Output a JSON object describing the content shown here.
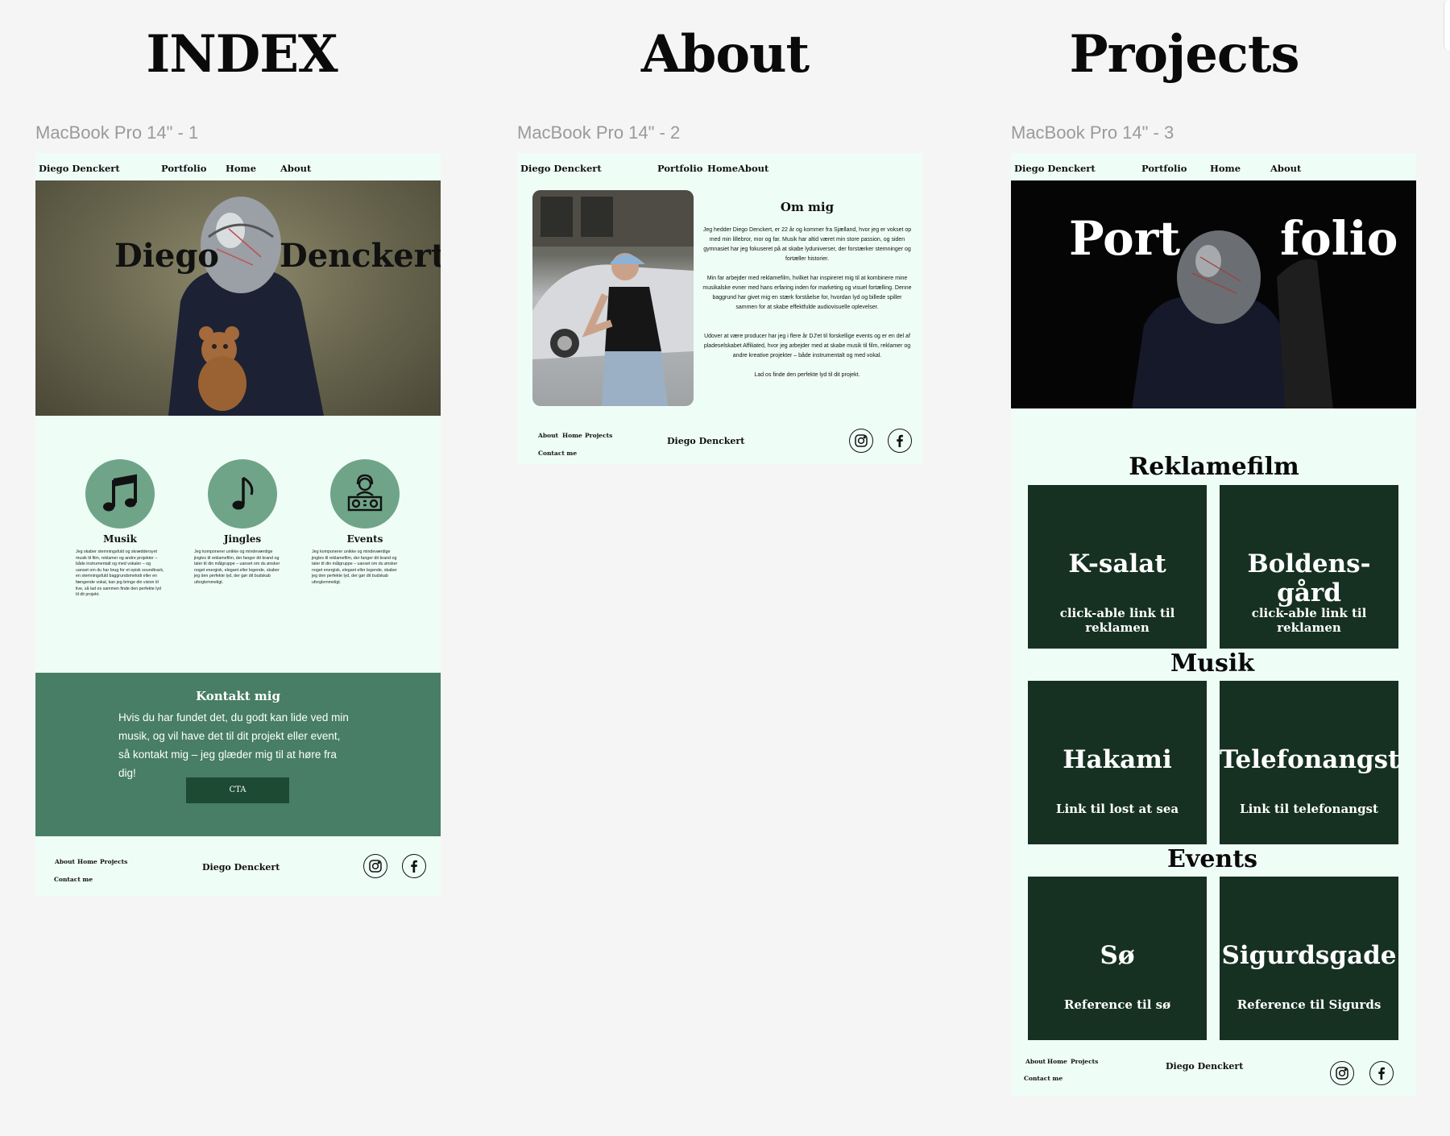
{
  "headings": {
    "index": "INDEX",
    "about": "About",
    "projects": "Projects"
  },
  "frame_labels": {
    "f1": "MacBook Pro 14\" - 1",
    "f2": "MacBook Pro 14\" - 2",
    "f3": "MacBook Pro 14\" - 3"
  },
  "nav": {
    "brand": "Diego Denckert",
    "portfolio": "Portfolio",
    "home": "Home",
    "about": "About"
  },
  "index": {
    "hero_first": "Diego",
    "hero_last": "Denckert",
    "services": [
      {
        "title": "Musik",
        "icon": "music-notes-icon",
        "text": "Jeg skaber stemningsfuld og skræddersyet musik til film, reklamer og andre projekter – både instrumentalt og med vokaler – og uanset om du har brug for et episk soundtrack, en stemningsfuld baggrundsmelodi eller en fængende vokal, kan jeg bringe din vision til live, så lad os sammen finde den perfekte lyd til dit projekt."
      },
      {
        "title": "Jingles",
        "icon": "music-note-icon",
        "text": "Jeg komponerer unikke og mindeværdige jingles til reklamefilm, der fanger dit brand og taler til din målgruppe – uanset om du ønsker noget energisk, elegant eller legende, skaber jeg den perfekte lyd, der gør dit budskab uforglemmeligt."
      },
      {
        "title": "Events",
        "icon": "dj-icon",
        "text": "Jeg komponerer unikke og mindeværdige jingles til reklamefilm, der fanger dit brand og taler til din målgruppe – uanset om du ønsker noget energisk, elegant eller legende, skaber jeg den perfekte lyd, der gør dit budskab uforglemmeligt."
      }
    ],
    "contact_title": "Kontakt mig",
    "contact_text": "Hvis du har fundet det, du godt kan lide ved min musik, og vil have det til dit projekt eller event, så kontakt mig – jeg glæder mig til at høre fra dig!",
    "cta": "CTA"
  },
  "footer": {
    "about": "About",
    "home": "Home",
    "projects": "Projects",
    "contact": "Contact me",
    "brand": "Diego Denckert"
  },
  "about": {
    "title": "Om mig",
    "p1": "Jeg hedder Diego Denckert, er 22 år og kommer fra Sjælland, hvor jeg er vokset op med min lillebror, mor og far. Musik har altid været min store passion, og siden gymnasiet har jeg fokuseret på at skabe lyduniverser, der forstærker stemninger og fortæller historier.",
    "p2": "Min far arbejder med reklamefilm, hvilket har inspireret mig til at kombinere mine musikalske evner med hans erfaring inden for marketing og visuel fortælling. Denne baggrund har givet mig en stærk forståelse for, hvordan lyd og billede spiller sammen for at skabe effektfulde audiovisuelle oplevelser.",
    "p3": "Udover at være producer har jeg i flere år DJ'et til forskellige events og er en del af pladeselskabet Affiliated, hvor jeg arbejder med at skabe musik til film, reklamer og andre kreative projekter – både instrumentalt og med vokal.",
    "p4": "Lad os finde den perfekte lyd til dit projekt."
  },
  "projects": {
    "hero_left": "Port",
    "hero_right": "folio",
    "categories": [
      {
        "title": "Reklamefilm",
        "tiles": [
          {
            "title": "K-salat",
            "sub": "click-able link til reklamen"
          },
          {
            "title": "Boldens-gård",
            "sub": "click-able link til reklamen"
          }
        ]
      },
      {
        "title": "Musik",
        "tiles": [
          {
            "title": "Hakami",
            "sub": "Link til lost at sea"
          },
          {
            "title": "Telefonangst",
            "sub": "Link til telefonangst"
          }
        ]
      },
      {
        "title": "Events",
        "tiles": [
          {
            "title": "Sø",
            "sub": "Reference til sø"
          },
          {
            "title": "Sigurdsgade",
            "sub": "Reference til Sigurds"
          }
        ]
      }
    ]
  },
  "colors": {
    "frame_bg": "#effdf7",
    "accent_green": "#6fa488",
    "contact_green": "#477e65",
    "cta_dark": "#1d4a33",
    "tile_dark": "#163122"
  }
}
